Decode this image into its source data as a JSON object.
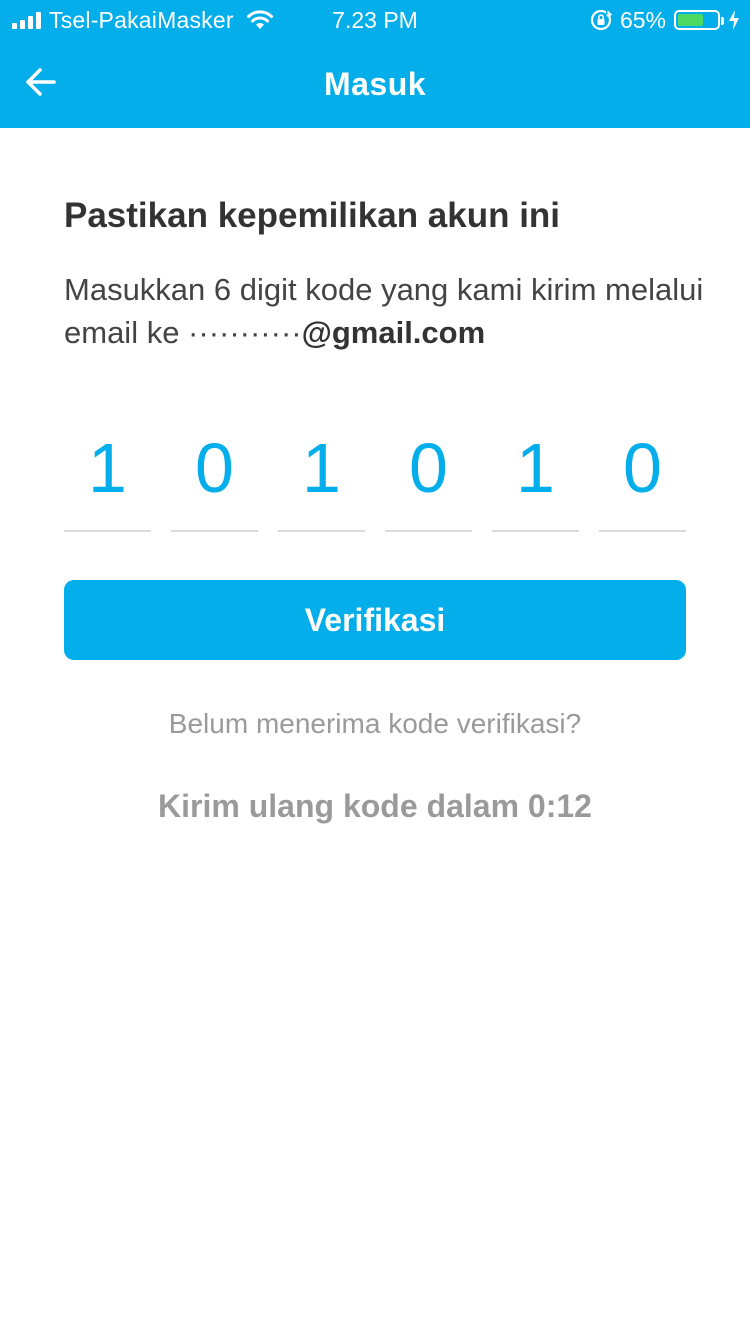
{
  "status_bar": {
    "carrier": "Tsel-PakaiMasker",
    "time": "7.23 PM",
    "battery_percent": "65%",
    "battery_level": 0.65,
    "icons": [
      "signal-icon",
      "wifi-icon",
      "orientation-lock-icon",
      "battery-icon",
      "charging-bolt-icon"
    ]
  },
  "navbar": {
    "title": "Masuk",
    "back_icon": "arrow-left-icon"
  },
  "content": {
    "heading": "Pastikan kepemilikan akun ini",
    "description": "Masukkan 6 digit kode yang kami kirim melalui email ke ",
    "masked_email_prefix": "···········",
    "email_domain": "@gmail.com",
    "otp_digits": [
      "1",
      "0",
      "1",
      "0",
      "1",
      "0"
    ],
    "verify_label": "Verifikasi",
    "hint": "Belum menerima kode verifikasi?",
    "resend": "Kirim ulang kode dalam 0:12"
  },
  "colors": {
    "accent": "#03aeeb",
    "battery_fill": "#4cd964",
    "text_dark": "#333333",
    "text_muted": "#9a9a9a",
    "divider": "#d9d9d9"
  }
}
